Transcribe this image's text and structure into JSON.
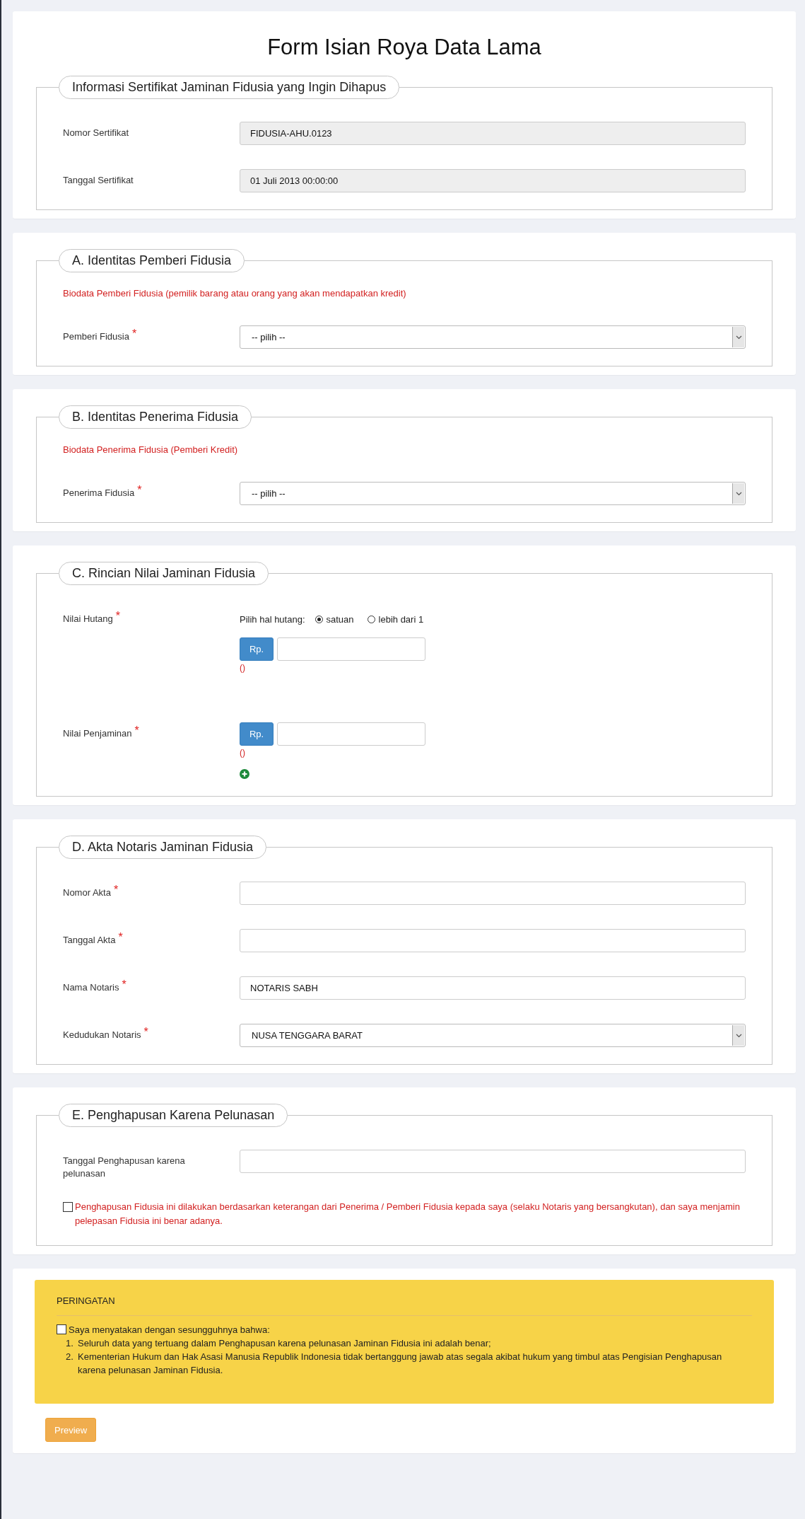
{
  "title": "Form Isian Roya Data Lama",
  "required_mark": "*",
  "sections": [
    {
      "legend": "Informasi Sertifikat Jaminan Fidusia yang Ingin Dihapus",
      "fields": [
        {
          "kind": "text",
          "label": "Nomor Sertifikat",
          "value": "FIDUSIA-AHU.0123",
          "readonly": true
        },
        {
          "kind": "text",
          "label": "Tanggal Sertifikat",
          "value": "01 Juli 2013 00:00:00",
          "readonly": true
        }
      ]
    },
    {
      "legend": "A. Identitas Pemberi Fidusia",
      "note": "Biodata Pemberi Fidusia (pemilik barang atau orang yang akan mendapatkan kredit)",
      "fields": [
        {
          "kind": "select",
          "label": "Pemberi Fidusia",
          "required": true,
          "value": "-- pilih --"
        }
      ]
    },
    {
      "legend": "B. Identitas Penerima Fidusia",
      "note": "Biodata Penerima Fidusia (Pemberi Kredit)",
      "fields": [
        {
          "kind": "select",
          "label": "Penerima Fidusia",
          "required": true,
          "value": "-- pilih --"
        }
      ]
    },
    {
      "legend": "C. Rincian Nilai Jaminan Fidusia",
      "fields": [
        {
          "kind": "money",
          "label": "Nilai Hutang",
          "required": true,
          "prompt": "Pilih hal hutang:",
          "options": [
            {
              "label": "satuan",
              "selected": true
            },
            {
              "label": "lebih dari 1",
              "selected": false
            }
          ],
          "prefix": "Rp.",
          "hint": "()"
        },
        {
          "kind": "money",
          "label": "Nilai Penjaminan",
          "required": true,
          "prefix": "Rp.",
          "hint": "()",
          "add_button": true
        }
      ]
    },
    {
      "legend": "D. Akta Notaris Jaminan Fidusia",
      "fields": [
        {
          "kind": "text",
          "label": "Nomor Akta",
          "required": true,
          "readonly": false
        },
        {
          "kind": "text",
          "label": "Tanggal Akta",
          "required": true,
          "readonly": false
        },
        {
          "kind": "text",
          "label": "Nama Notaris",
          "required": true,
          "value": "NOTARIS SABH",
          "readonly": false
        },
        {
          "kind": "select",
          "label": "Kedudukan Notaris",
          "required": true,
          "value": "NUSA TENGGARA BARAT"
        }
      ]
    },
    {
      "legend": "E. Penghapusan Karena Pelunasan",
      "fields": [
        {
          "kind": "text",
          "label": "Tanggal Penghapusan karena pelunasan",
          "readonly": false
        }
      ],
      "statement": {
        "text": "Penghapusan Fidusia ini dilakukan berdasarkan keterangan dari Penerima / Pemberi Fidusia kepada saya (selaku Notaris yang bersangkutan), dan saya menjamin pelepasan Fidusia ini benar adanya.",
        "checked": false
      }
    }
  ],
  "warning": {
    "title": "PERINGATAN",
    "statement": {
      "text": "Saya menyatakan dengan sesungguhnya bahwa:",
      "checked": false
    },
    "items": [
      {
        "number": "1.",
        "text": "Seluruh data yang tertuang dalam Penghapusan karena pelunasan Jaminan Fidusia ini adalah benar;"
      },
      {
        "number": "2.",
        "text": "Kementerian Hukum dan Hak Asasi Manusia Republik Indonesia tidak bertanggung jawab atas segala akibat hukum yang timbul atas Pengisian Penghapusan karena pelunasan Jaminan Fidusia."
      }
    ]
  },
  "buttons": [
    "Preview"
  ]
}
